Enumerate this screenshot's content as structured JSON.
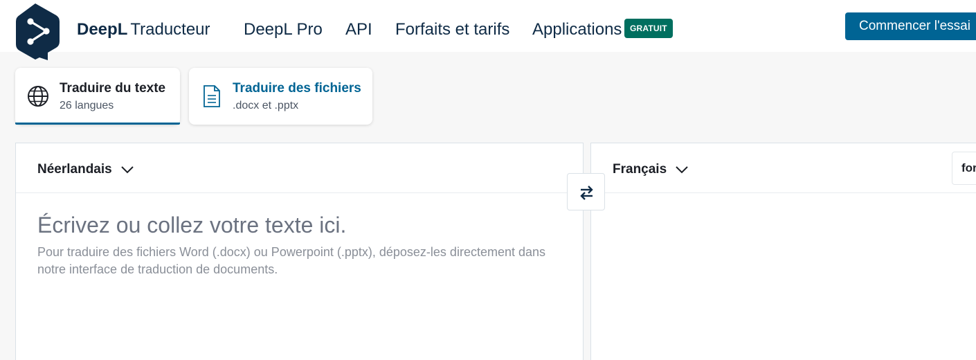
{
  "brand": {
    "name": "DeepL",
    "product": "Traducteur"
  },
  "nav": [
    {
      "label": "DeepL Pro"
    },
    {
      "label": "API"
    },
    {
      "label": "Forfaits et tarifs"
    },
    {
      "label": "Applications",
      "badge": "GRATUIT"
    }
  ],
  "cta": {
    "label": "Commencer l'essai"
  },
  "tabs": [
    {
      "title": "Traduire du texte",
      "subtitle": "26 langues",
      "icon": "globe-icon",
      "active": true
    },
    {
      "title": "Traduire des fichiers",
      "subtitle": ".docx et .pptx",
      "icon": "document-icon",
      "active": false
    }
  ],
  "source": {
    "language": "Néerlandais",
    "placeholder": "Écrivez ou collez votre texte ici.",
    "hint": "Pour traduire des fichiers Word (.docx) ou Powerpoint (.pptx), déposez-les directement dans notre interface de traduction de documents."
  },
  "target": {
    "language": "Français",
    "formality_label": "formel"
  },
  "swap": {
    "icon": "swap-arrows-icon"
  },
  "colors": {
    "brand_dark": "#0f2b46",
    "accent_blue": "#006494",
    "badge_green": "#006f5f",
    "background": "#f7f7f7"
  }
}
